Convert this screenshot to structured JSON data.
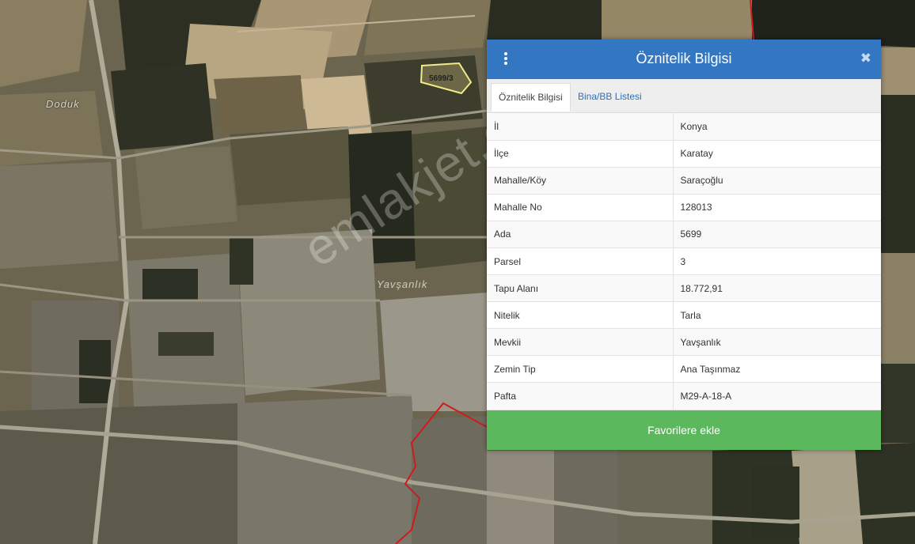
{
  "map": {
    "place_label_1": "Doduk",
    "place_label_2": "Yavşanlık",
    "parcel_label": "5699/3",
    "watermark": "emlakjet.com"
  },
  "panel": {
    "title": "Öznitelik Bilgisi",
    "close_icon": "close-icon",
    "menu_icon": "vertical-dots-icon",
    "tabs": [
      {
        "label": "Öznitelik Bilgisi",
        "active": true
      },
      {
        "label": "Bina/BB Listesi",
        "active": false
      }
    ],
    "rows": [
      {
        "key": "İl",
        "value": "Konya"
      },
      {
        "key": "İlçe",
        "value": "Karatay"
      },
      {
        "key": "Mahalle/Köy",
        "value": "Saraçoğlu"
      },
      {
        "key": "Mahalle No",
        "value": "128013"
      },
      {
        "key": "Ada",
        "value": "5699"
      },
      {
        "key": "Parsel",
        "value": "3"
      },
      {
        "key": "Tapu Alanı",
        "value": "18.772,91"
      },
      {
        "key": "Nitelik",
        "value": "Tarla"
      },
      {
        "key": "Mevkii",
        "value": "Yavşanlık"
      },
      {
        "key": "Zemin Tip",
        "value": "Ana Taşınmaz"
      },
      {
        "key": "Pafta",
        "value": "M29-A-18-A"
      }
    ],
    "favorite_button": "Favorilere ekle"
  },
  "colors": {
    "header": "#3377c2",
    "favorite_button": "#5cb85c",
    "tab_link": "#2f6fb5",
    "boundary_line": "#d11a1a",
    "parcel_outline": "#f1ec8a"
  }
}
